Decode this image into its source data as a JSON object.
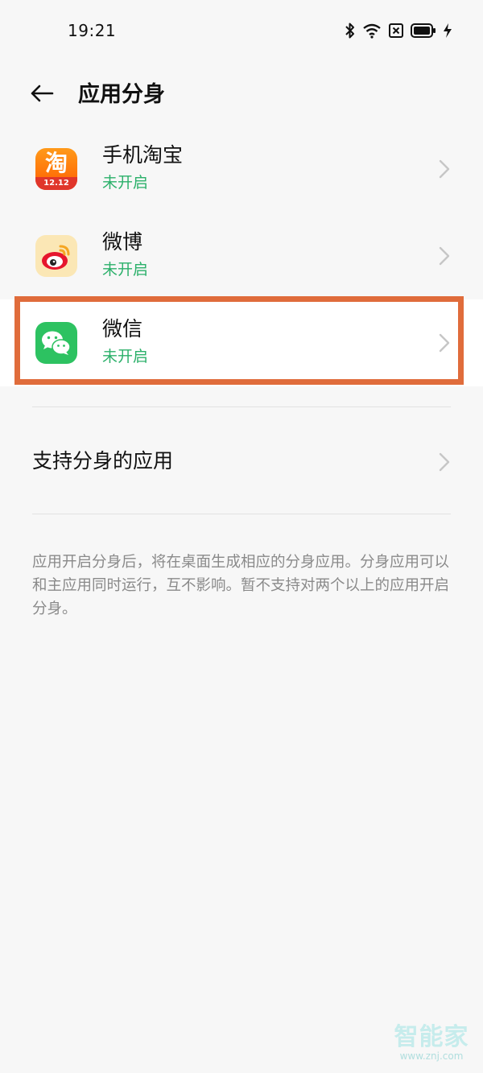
{
  "status_bar": {
    "time": "19:21",
    "icons": [
      "bluetooth-icon",
      "wifi-icon",
      "sim-blocked-icon",
      "battery-icon",
      "charging-icon"
    ]
  },
  "header": {
    "title": "应用分身",
    "back_icon": "arrow-left-icon"
  },
  "apps": [
    {
      "name": "手机淘宝",
      "status": "未开启",
      "icon": "taobao-icon",
      "icon_badge": "12.12",
      "icon_char": "淘"
    },
    {
      "name": "微博",
      "status": "未开启",
      "icon": "weibo-icon"
    },
    {
      "name": "微信",
      "status": "未开启",
      "icon": "wechat-icon"
    }
  ],
  "support": {
    "label": "支持分身的应用"
  },
  "footnote": "应用开启分身后，将在桌面生成相应的分身应用。分身应用可以和主应用同时运行，互不影响。暂不支持对两个以上的应用开启分身。",
  "watermark": {
    "brand": "智能家",
    "url": "www.znj.com"
  },
  "colors": {
    "accent_green": "#2bb06a",
    "highlight": "#e06c3b",
    "background": "#f7f7f7"
  }
}
